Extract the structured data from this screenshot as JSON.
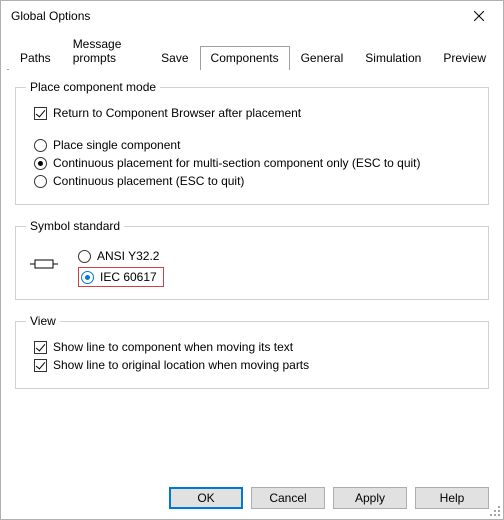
{
  "window": {
    "title": "Global Options"
  },
  "tabs": {
    "items": [
      {
        "label": "Paths"
      },
      {
        "label": "Message prompts"
      },
      {
        "label": "Save"
      },
      {
        "label": "Components"
      },
      {
        "label": "General"
      },
      {
        "label": "Simulation"
      },
      {
        "label": "Preview"
      }
    ],
    "active_index": 3
  },
  "place_mode": {
    "legend": "Place component mode",
    "return_checkbox": {
      "label": "Return to Component Browser after placement",
      "checked": true
    },
    "options": [
      {
        "label": "Place single component",
        "selected": false
      },
      {
        "label": "Continuous placement for multi-section component only (ESC to quit)",
        "selected": true
      },
      {
        "label": "Continuous placement (ESC to quit)",
        "selected": false
      }
    ]
  },
  "symbol_standard": {
    "legend": "Symbol standard",
    "options": [
      {
        "label": "ANSI Y32.2",
        "selected": false
      },
      {
        "label": "IEC 60617",
        "selected": true
      }
    ]
  },
  "view": {
    "legend": "View",
    "options": [
      {
        "label": "Show line to component when moving its text",
        "checked": true
      },
      {
        "label": "Show line to original location when moving parts",
        "checked": true
      }
    ]
  },
  "buttons": {
    "ok": "OK",
    "cancel": "Cancel",
    "apply": "Apply",
    "help": "Help"
  }
}
